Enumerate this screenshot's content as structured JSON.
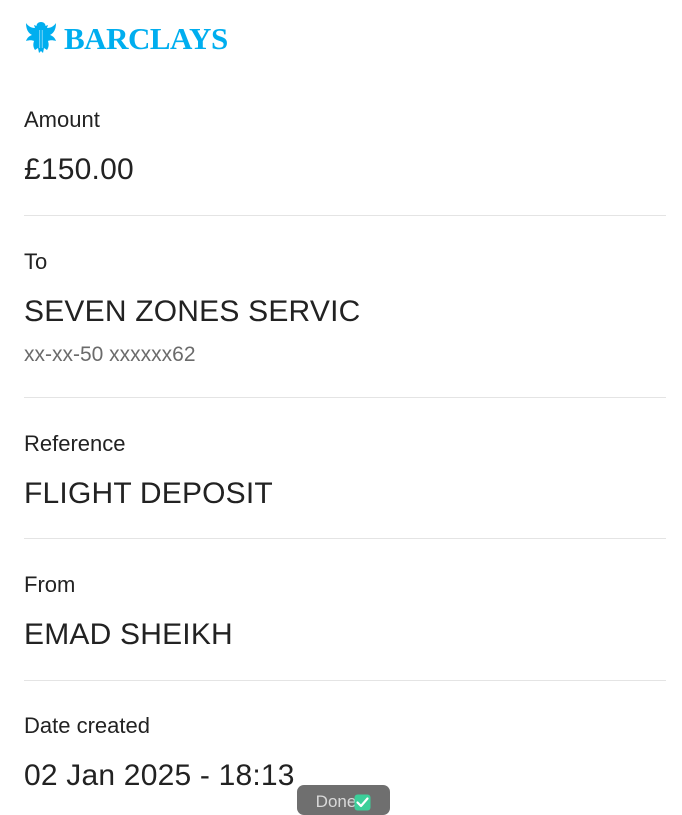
{
  "brand": {
    "name": "BARCLAYS",
    "logo_icon": "eagle-logo-icon",
    "color": "#00aeef"
  },
  "details": {
    "amount": {
      "label": "Amount",
      "value": "£150.00"
    },
    "to": {
      "label": "To",
      "value": "SEVEN ZONES SERVIC",
      "account": "xx-xx-50 xxxxxx62"
    },
    "reference": {
      "label": "Reference",
      "value": "FLIGHT DEPOSIT"
    },
    "from": {
      "label": "From",
      "value": "EMAD SHEIKH"
    },
    "date_created": {
      "label": "Date created",
      "value": "02 Jan 2025 - 18:13"
    }
  },
  "done_button": {
    "label": "Done",
    "icon": "check-icon",
    "check_color": "#3ccf9a"
  }
}
